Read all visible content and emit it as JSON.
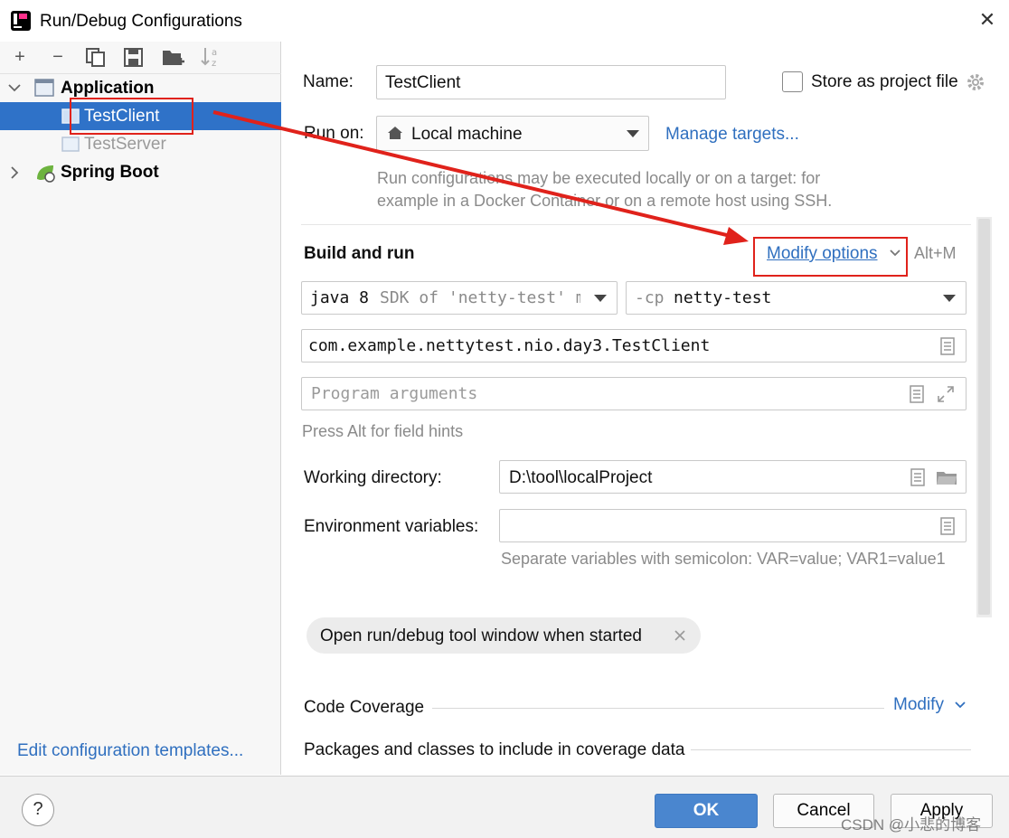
{
  "window": {
    "title": "Run/Debug Configurations",
    "close_glyph": "✕"
  },
  "toolbar": {
    "add": "+",
    "remove": "−"
  },
  "tree": {
    "application_label": "Application",
    "items": [
      "TestClient",
      "TestServer"
    ],
    "spring_boot_label": "Spring Boot"
  },
  "left_footer": {
    "edit_templates": "Edit configuration templates..."
  },
  "form": {
    "name_label": "Name:",
    "name_value": "TestClient",
    "store_label": "Store as project file",
    "run_on_label": "Run on:",
    "run_on_value": "Local machine",
    "manage_targets": "Manage targets...",
    "run_on_hint_1": "Run configurations may be executed locally or on a target: for",
    "run_on_hint_2": "example in a Docker Container or on a remote host using SSH.",
    "build_and_run": "Build and run",
    "modify_options": "Modify options",
    "modify_shortcut": "Alt+M",
    "jdk_java": "java 8",
    "jdk_sdk": "SDK of 'netty-test' m",
    "cp_prefix": "-cp",
    "cp_value": "netty-test",
    "main_class": "com.example.nettytest.nio.day3.TestClient",
    "program_args_placeholder": "Program arguments",
    "field_hints": "Press Alt for field hints",
    "working_dir_label": "Working directory:",
    "working_dir_value": "D:\\tool\\localProject",
    "env_label": "Environment variables:",
    "env_value": "",
    "env_hint": "Separate variables with semicolon: VAR=value; VAR1=value1",
    "chip_label": "Open run/debug tool window when started",
    "code_coverage": "Code Coverage",
    "modify": "Modify",
    "packages_label": "Packages and classes to include in coverage data"
  },
  "buttons": {
    "help": "?",
    "ok": "OK",
    "cancel": "Cancel",
    "apply": "Apply"
  },
  "watermark": "CSDN @小悲的博客",
  "colors": {
    "selection": "#2f72c8",
    "link": "#2f6fbf",
    "primary_button": "#4a86cf",
    "annotation_red": "#e0221b"
  }
}
